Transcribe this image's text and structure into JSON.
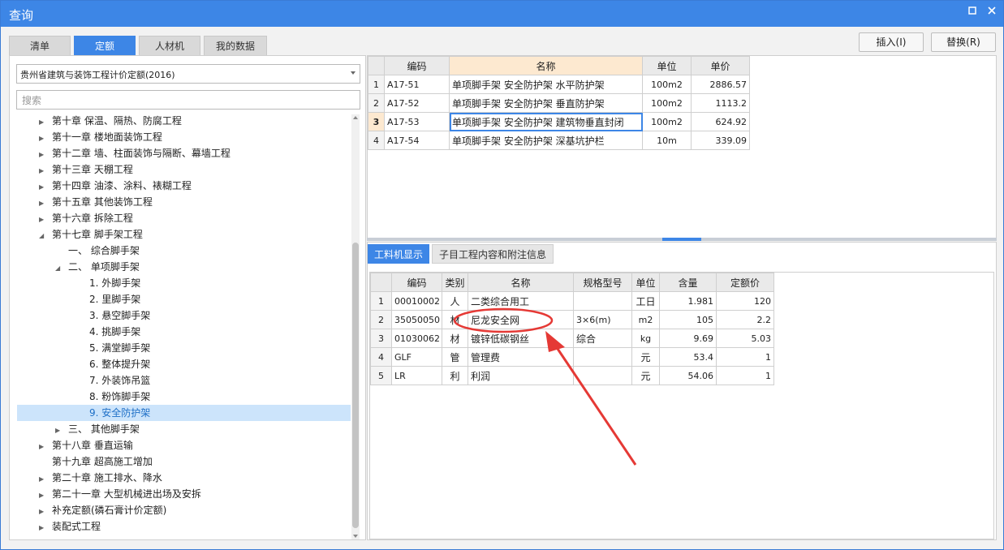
{
  "window": {
    "title": "查询",
    "restore_icon": "restore-icon",
    "close_icon": "close-icon"
  },
  "tabs": [
    {
      "label": "清单",
      "active": false
    },
    {
      "label": "定额",
      "active": true
    },
    {
      "label": "人材机",
      "active": false
    },
    {
      "label": "我的数据",
      "active": false
    }
  ],
  "actions": {
    "insert": "插入(I)",
    "replace": "替换(R)"
  },
  "library": {
    "selected": "贵州省建筑与装饰工程计价定额(2016)"
  },
  "search": {
    "placeholder": "搜索",
    "value": ""
  },
  "tree": [
    {
      "label": "第十章 保温、隔热、防腐工程",
      "level": 0,
      "expander": "collapsed"
    },
    {
      "label": "第十一章 楼地面装饰工程",
      "level": 0,
      "expander": "collapsed"
    },
    {
      "label": "第十二章 墙、柱面装饰与隔断、幕墙工程",
      "level": 0,
      "expander": "collapsed"
    },
    {
      "label": "第十三章 天棚工程",
      "level": 0,
      "expander": "collapsed"
    },
    {
      "label": "第十四章 油漆、涂料、裱糊工程",
      "level": 0,
      "expander": "collapsed"
    },
    {
      "label": "第十五章 其他装饰工程",
      "level": 0,
      "expander": "collapsed"
    },
    {
      "label": "第十六章 拆除工程",
      "level": 0,
      "expander": "collapsed"
    },
    {
      "label": "第十七章 脚手架工程",
      "level": 0,
      "expander": "expanded"
    },
    {
      "label": "一、 综合脚手架",
      "level": 1,
      "expander": "none"
    },
    {
      "label": "二、 单项脚手架",
      "level": 1,
      "expander": "expanded"
    },
    {
      "label": "1. 外脚手架",
      "level": 2,
      "expander": "none"
    },
    {
      "label": "2. 里脚手架",
      "level": 2,
      "expander": "none"
    },
    {
      "label": "3. 悬空脚手架",
      "level": 2,
      "expander": "none"
    },
    {
      "label": "4. 挑脚手架",
      "level": 2,
      "expander": "none"
    },
    {
      "label": "5. 满堂脚手架",
      "level": 2,
      "expander": "none"
    },
    {
      "label": "6. 整体提升架",
      "level": 2,
      "expander": "none"
    },
    {
      "label": "7. 外装饰吊篮",
      "level": 2,
      "expander": "none"
    },
    {
      "label": "8. 粉饰脚手架",
      "level": 2,
      "expander": "none"
    },
    {
      "label": "9. 安全防护架",
      "level": 2,
      "expander": "none",
      "selected": true
    },
    {
      "label": "三、 其他脚手架",
      "level": 1,
      "expander": "collapsed"
    },
    {
      "label": "第十八章 垂直运输",
      "level": 0,
      "expander": "collapsed"
    },
    {
      "label": "第十九章 超高施工增加",
      "level": 0,
      "expander": "none"
    },
    {
      "label": "第二十章 施工排水、降水",
      "level": 0,
      "expander": "collapsed"
    },
    {
      "label": "第二十一章 大型机械进出场及安拆",
      "level": 0,
      "expander": "collapsed"
    },
    {
      "label": "补充定额(磷石膏计价定额)",
      "level": 0,
      "expander": "collapsed"
    },
    {
      "label": "装配式工程",
      "level": 0,
      "expander": "collapsed"
    }
  ],
  "quota_table": {
    "columns": [
      "编码",
      "名称",
      "单位",
      "单价"
    ],
    "rows": [
      {
        "no": "1",
        "code": "A17-51",
        "name": "单项脚手架 安全防护架 水平防护架",
        "unit": "100m2",
        "price": "2886.57"
      },
      {
        "no": "2",
        "code": "A17-52",
        "name": "单项脚手架 安全防护架 垂直防护架",
        "unit": "100m2",
        "price": "1113.2"
      },
      {
        "no": "3",
        "code": "A17-53",
        "name": "单项脚手架 安全防护架 建筑物垂直封闭",
        "unit": "100m2",
        "price": "624.92"
      },
      {
        "no": "4",
        "code": "A17-54",
        "name": "单项脚手架 安全防护架 深基坑护栏",
        "unit": "10m",
        "price": "339.09"
      }
    ],
    "selected_row": 3
  },
  "bottom_tabs": [
    {
      "label": "工料机显示",
      "active": true
    },
    {
      "label": "子目工程内容和附注信息",
      "active": false
    }
  ],
  "material_table": {
    "columns": [
      "编码",
      "类别",
      "名称",
      "规格型号",
      "单位",
      "含量",
      "定额价"
    ],
    "rows": [
      {
        "no": "1",
        "code": "00010002",
        "type": "人",
        "name": "二类综合用工",
        "spec": "",
        "unit": "工日",
        "qty": "1.981",
        "price": "120"
      },
      {
        "no": "2",
        "code": "35050050",
        "type": "材",
        "name": "尼龙安全网",
        "spec": "3×6(m)",
        "unit": "m2",
        "qty": "105",
        "price": "2.2"
      },
      {
        "no": "3",
        "code": "01030062",
        "type": "材",
        "name": "镀锌低碳钢丝",
        "spec": "综合",
        "unit": "kg",
        "qty": "9.69",
        "price": "5.03"
      },
      {
        "no": "4",
        "code": "GLF",
        "type": "管",
        "name": "管理费",
        "spec": "",
        "unit": "元",
        "qty": "53.4",
        "price": "1"
      },
      {
        "no": "5",
        "code": "LR",
        "type": "利",
        "name": "利润",
        "spec": "",
        "unit": "元",
        "qty": "54.06",
        "price": "1"
      }
    ]
  },
  "annotation": {
    "color": "#e53935",
    "highlight_target": "尼龙安全网"
  },
  "colors": {
    "accent": "#3d86e6",
    "selection": "#cce4fb",
    "header_highlight": "#fde9d0"
  }
}
